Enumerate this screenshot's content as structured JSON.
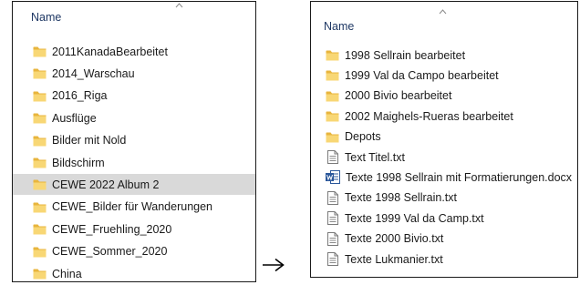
{
  "left_pane": {
    "column_header": "Name",
    "items": [
      {
        "label": "2011KanadaBearbeitet",
        "type": "folder",
        "selected": false
      },
      {
        "label": "2014_Warschau",
        "type": "folder",
        "selected": false
      },
      {
        "label": "2016_Riga",
        "type": "folder",
        "selected": false
      },
      {
        "label": "Ausflüge",
        "type": "folder",
        "selected": false
      },
      {
        "label": "Bilder mit Nold",
        "type": "folder",
        "selected": false
      },
      {
        "label": "Bildschirm",
        "type": "folder",
        "selected": false
      },
      {
        "label": "CEWE 2022 Album 2",
        "type": "folder",
        "selected": true
      },
      {
        "label": "CEWE_Bilder für Wanderungen",
        "type": "folder",
        "selected": false
      },
      {
        "label": "CEWE_Fruehling_2020",
        "type": "folder",
        "selected": false
      },
      {
        "label": "CEWE_Sommer_2020",
        "type": "folder",
        "selected": false
      },
      {
        "label": "China",
        "type": "folder",
        "selected": false
      }
    ]
  },
  "right_pane": {
    "column_header": "Name",
    "items": [
      {
        "label": "1998 Sellrain bearbeitet",
        "type": "folder"
      },
      {
        "label": "1999 Val da Campo bearbeitet",
        "type": "folder"
      },
      {
        "label": "2000 Bivio bearbeitet",
        "type": "folder"
      },
      {
        "label": "2002 Maighels-Rueras bearbeitet",
        "type": "folder"
      },
      {
        "label": "Depots",
        "type": "folder"
      },
      {
        "label": "Text Titel.txt",
        "type": "text-file"
      },
      {
        "label": "Texte 1998 Sellrain mit Formatierungen.docx",
        "type": "word-document"
      },
      {
        "label": "Texte 1998 Sellrain.txt",
        "type": "text-file"
      },
      {
        "label": "Texte 1999 Val da Camp.txt",
        "type": "text-file"
      },
      {
        "label": "Texte 2000 Bivio.txt",
        "type": "text-file"
      },
      {
        "label": "Texte Lukmanier.txt",
        "type": "text-file"
      }
    ]
  },
  "colors": {
    "folder": "#f8d775",
    "folder_dark": "#e8b53d",
    "selection": "#d9d9d9",
    "header_text": "#1f3864",
    "word_blue": "#2b579a"
  },
  "arrow_icon": "right-arrow-icon"
}
